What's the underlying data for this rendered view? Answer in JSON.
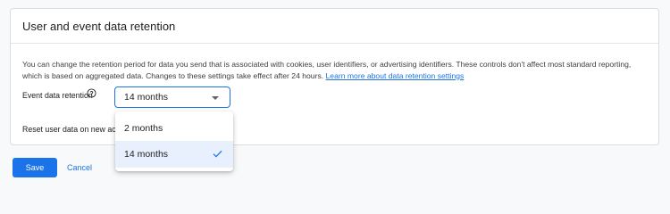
{
  "section": {
    "title": "User and event data retention",
    "description": "You can change the retention period for data you send that is associated with cookies, user identifiers, or advertising identifiers. These controls don't affect most standard reporting, which is based on aggregated data. Changes to these settings take effect after 24 hours.",
    "learn_more_link": "Learn more about data retention settings"
  },
  "event_retention": {
    "label": "Event data retention",
    "help_icon": "help-circle-icon",
    "selected_value": "14 months",
    "options": [
      {
        "label": "2 months",
        "selected": false
      },
      {
        "label": "14 months",
        "selected": true
      }
    ]
  },
  "reset_user_data": {
    "label_visible": "Reset user data on new ac"
  },
  "actions": {
    "save_label": "Save",
    "cancel_label": "Cancel"
  },
  "colors": {
    "accent": "#1a73e8",
    "selected_option_bg": "#e8f0fe",
    "page_bg": "#f8f9fa"
  }
}
